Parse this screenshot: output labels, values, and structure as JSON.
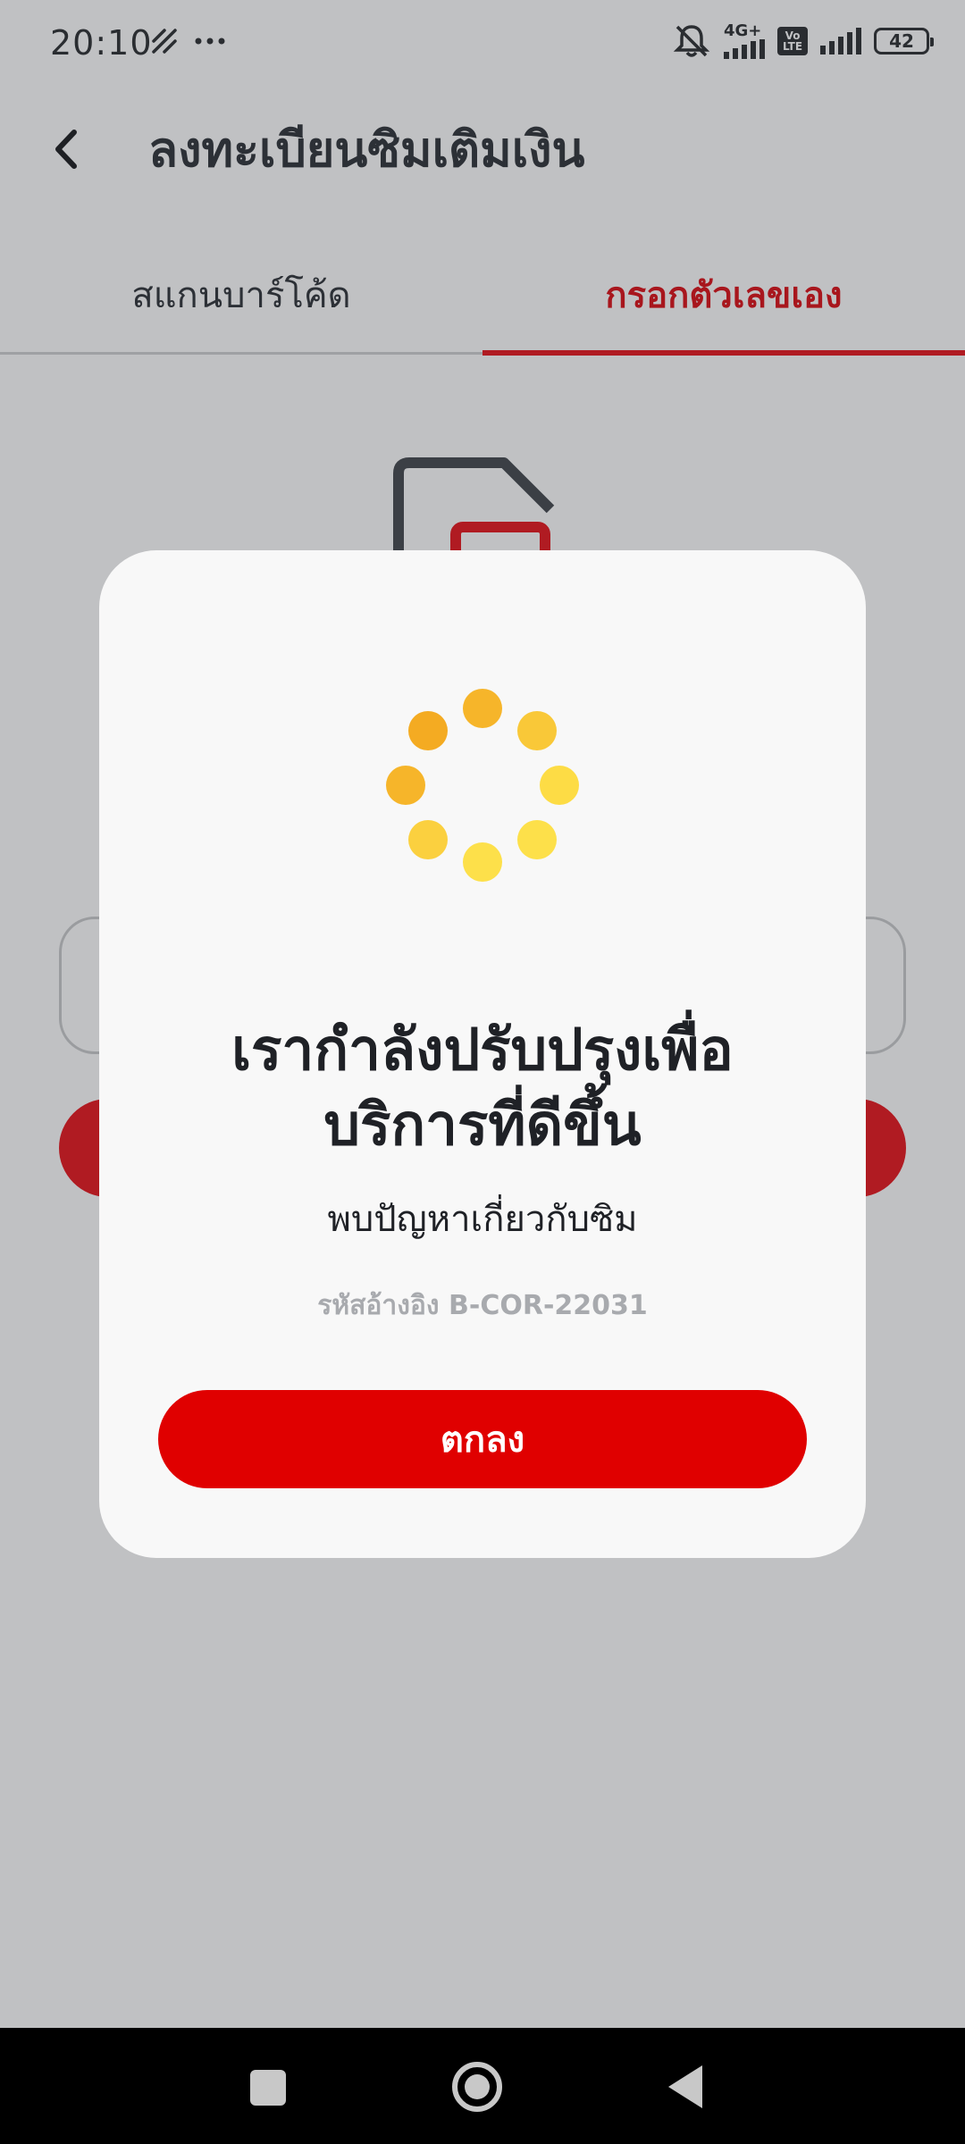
{
  "status_bar": {
    "time": "20:10",
    "network_label": "4G+",
    "volte_label": "Vo LTE",
    "battery_level": "42"
  },
  "header": {
    "title": "ลงทะเบียนซิมเติมเงิน",
    "back_icon": "chevron-left-icon"
  },
  "tabs": [
    {
      "label": "สแกนบาร์โค้ด",
      "active": false
    },
    {
      "label": "กรอกตัวเลขเอง",
      "active": true
    }
  ],
  "modal": {
    "title_line1": "เรากำลังปรับปรุงเพื่อ",
    "title_line2": "บริการที่ดีขึ้น",
    "subtitle": "พบปัญหาเกี่ยวกับซิม",
    "reference": "รหัสอ้างอิง B-COR-22031",
    "ok_label": "ตกลง",
    "spinner_icon": "loading-spinner-icon"
  },
  "colors": {
    "accent": "#b01b22",
    "ok_button": "#e00000",
    "spinner_dark": "#f4b023",
    "spinner_light": "#fde24a",
    "overlay": "#c0c1c3"
  }
}
